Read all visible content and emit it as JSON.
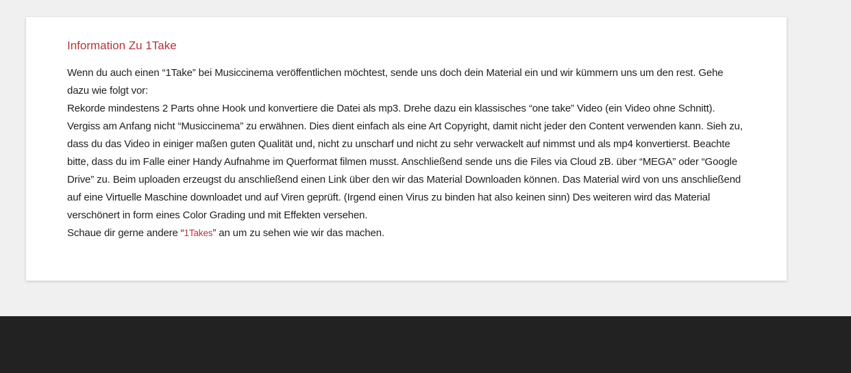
{
  "card": {
    "title": "Information Zu 1Take",
    "intro": "Wenn du auch einen “1Take” bei Musiccinema veröffentlichen möchtest, sende uns doch dein Material ein und wir kümmern uns um den rest. Gehe dazu wie folgt vor:",
    "instructions": "Rekorde mindestens 2 Parts ohne Hook und konvertiere die Datei als mp3. Drehe dazu ein klassisches “one take” Video (ein Video ohne Schnitt). Vergiss am Anfang nicht “Musiccinema” zu erwähnen. Dies dient einfach als eine Art Copyright, damit nicht jeder den Content verwenden kann. Sieh zu, dass du das Video in einiger maßen guten Qualität und, nicht zu unscharf und nicht zu sehr verwackelt auf nimmst und als mp4 konvertierst. Beachte bitte, dass du im Falle einer Handy Aufnahme im Querformat filmen musst. Anschließend sende uns die Files via Cloud zB. über “MEGA” oder “Google Drive” zu. Beim uploaden erzeugst du anschließend einen Link über den wir das Material Downloaden können. Das Material wird von uns anschließend auf eine Virtuelle Maschine downloadet und auf Viren geprüft. (Irgend einen Virus zu binden hat also keinen sinn) Des weiteren wird das Material verschönert in form eines Color Grading und mit Effekten versehen.",
    "closing_before": "Schaue dir gerne andere “",
    "closing_link": "1Takes",
    "closing_after": "” an um zu sehen wie wir das machen."
  },
  "colors": {
    "accent": "#b5343a",
    "page_background": "#f0f0f0",
    "footer_background": "#222222",
    "text": "#1f1f1f"
  }
}
